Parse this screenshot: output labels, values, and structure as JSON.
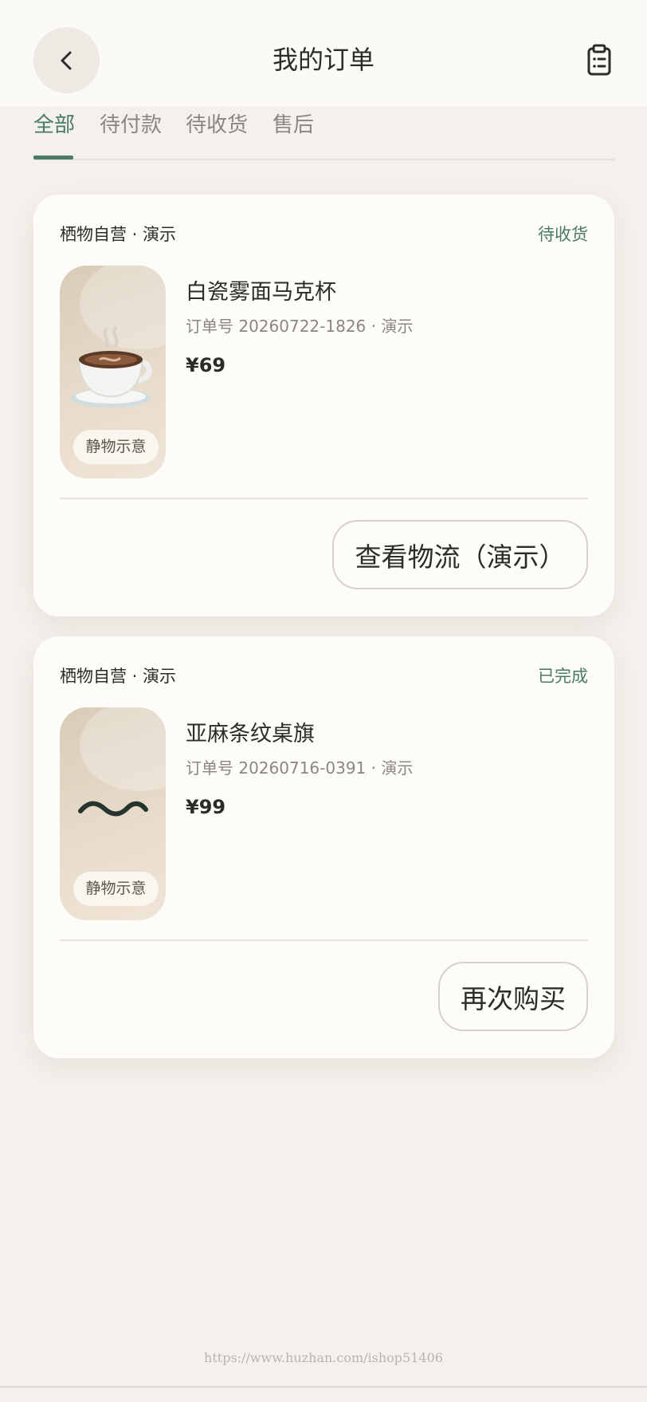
{
  "header": {
    "title": "我的订单",
    "back_icon": "chevron-left-icon",
    "orders_icon": "clipboard-list-icon"
  },
  "tabs": [
    {
      "label": "全部",
      "active": true
    },
    {
      "label": "待付款",
      "active": false
    },
    {
      "label": "待收货",
      "active": false
    },
    {
      "label": "售后",
      "active": false
    }
  ],
  "orders": [
    {
      "store": "栖物自营 · 演示",
      "status": "待收货",
      "thumb_icon": "coffee-cup-icon",
      "thumb_tag": "静物示意",
      "name": "白瓷雾面马克杯",
      "order_no": "订单号 20260722-1826 · 演示",
      "price": "¥69",
      "action": "查看物流（演示）"
    },
    {
      "store": "栖物自营 · 演示",
      "status": "已完成",
      "thumb_icon": "wave-icon",
      "thumb_tag": "静物示意",
      "name": "亚麻条纹桌旗",
      "order_no": "订单号 20260716-0391 · 演示",
      "price": "¥99",
      "action": "再次购买"
    }
  ],
  "watermark": "https://www.huzhan.com/ishop51406",
  "colors": {
    "accent": "#4a7b63",
    "background": "#f4f0eb",
    "card": "#fdfcf9"
  }
}
